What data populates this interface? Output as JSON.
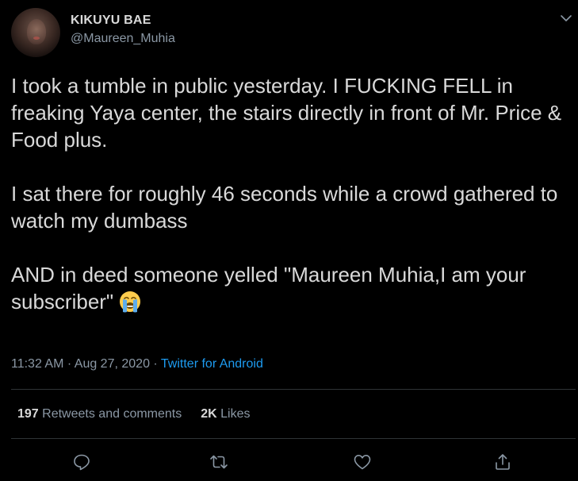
{
  "author": {
    "display_name": "KIKUYU BAE",
    "handle": "@Maureen_Muhia"
  },
  "tweet": {
    "paragraphs": [
      "I took a tumble in public yesterday. I FUCKING FELL in freaking Yaya center, the stairs directly in front of Mr. Price & Food plus.",
      "I sat there for roughly 46 seconds while a crowd gathered to watch my dumbass",
      "AND in deed someone yelled \"Maureen Muhia,I am your subscriber\""
    ],
    "emoji": "loudly-crying-face"
  },
  "meta": {
    "time": "11:32 AM",
    "separator": "·",
    "date": "Aug 27, 2020",
    "source": "Twitter for Android"
  },
  "stats": {
    "retweets_count": "197",
    "retweets_label": "Retweets and comments",
    "likes_count": "2K",
    "likes_label": "Likes"
  },
  "actions": [
    "reply-icon",
    "retweet-icon",
    "like-icon",
    "share-icon"
  ],
  "colors": {
    "background": "#000000",
    "text": "#d9d9d9",
    "secondary": "#8b98a5",
    "link": "#1d9bf0",
    "divider": "#2f3336"
  }
}
